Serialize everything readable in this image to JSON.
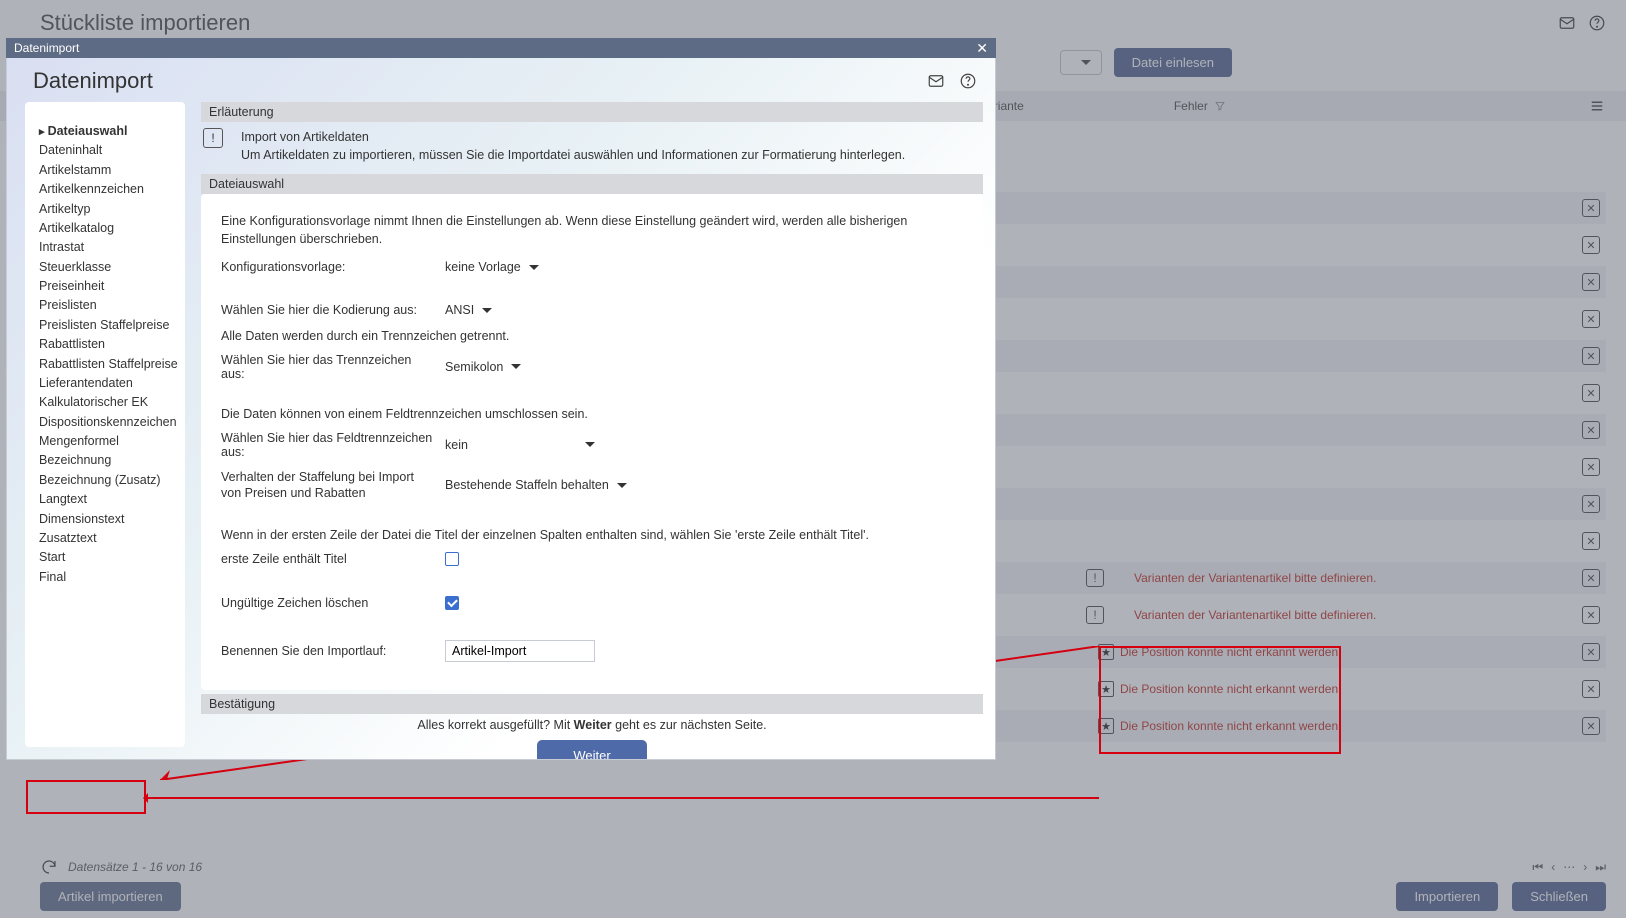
{
  "bg": {
    "title": "Stückliste importieren",
    "read_file_btn": "Datei einlesen",
    "columns": {
      "variante": "Variante",
      "fehler": "Fehler"
    },
    "footer_status": "Datensätze 1 - 16 von 16",
    "footer_btns": {
      "artikel": "Artikel importieren",
      "import": "Importieren",
      "close": "Schließen"
    },
    "rows": [
      {
        "type": "plain"
      },
      {
        "type": "plain"
      },
      {
        "type": "plain"
      },
      {
        "type": "plain"
      },
      {
        "type": "plain"
      },
      {
        "type": "plain"
      },
      {
        "type": "plain"
      },
      {
        "type": "plain"
      },
      {
        "type": "plain"
      },
      {
        "type": "plain"
      },
      {
        "type": "warn",
        "msg": "Varianten der Variantenartikel bitte definieren."
      },
      {
        "type": "warn",
        "msg": "Varianten der Variantenartikel bitte definieren."
      },
      {
        "type": "star",
        "msg": "Die Position konnte nicht erkannt werden."
      },
      {
        "type": "star",
        "msg": "Die Position konnte nicht erkannt werden."
      },
      {
        "type": "star",
        "msg": "Die Position konnte nicht erkannt werden."
      }
    ]
  },
  "modal": {
    "bar_title": "Datenimport",
    "title": "Datenimport",
    "nav": [
      "Dateiauswahl",
      "Dateninhalt",
      "Artikelstamm",
      "Artikelkennzeichen",
      "Artikeltyp",
      "Artikelkatalog",
      "Intrastat",
      "Steuerklasse",
      "Preiseinheit",
      "Preislisten",
      "Preislisten Staffelpreise",
      "Rabattlisten",
      "Rabattlisten Staffelpreise",
      "Lieferantendaten",
      "Kalkulatorischer EK",
      "Dispositionskennzeichen",
      "Mengenformel",
      "Bezeichnung",
      "Bezeichnung (Zusatz)",
      "Langtext",
      "Dimensionstext",
      "Zusatztext",
      "Start",
      "Final"
    ],
    "nav_selected": 0,
    "sect_erl": "Erläuterung",
    "erl_title": "Import von Artikeldaten",
    "erl_desc": "Um Artikeldaten zu importieren, müssen Sie die Importdatei auswählen und Informationen zur Formatierung hinterlegen.",
    "sect_file": "Dateiauswahl",
    "panel": {
      "intro": "Eine Konfigurationsvorlage nimmt Ihnen die Einstellungen ab. Wenn diese Einstellung geändert wird, werden alle bisherigen Einstellungen überschrieben.",
      "cfg_label": "Konfigurationsvorlage:",
      "cfg_value": "keine Vorlage",
      "enc_label": "Wählen Sie hier die Kodierung aus:",
      "enc_value": "ANSI",
      "sep_note": "Alle Daten werden durch ein Trennzeichen getrennt.",
      "sep_label": "Wählen Sie hier das Trennzeichen aus:",
      "sep_value": "Semikolon",
      "field_note": "Die Daten können von einem Feldtrennzeichen umschlossen sein.",
      "field_label": "Wählen Sie hier das Feldtrennzeichen aus:",
      "field_value": "kein",
      "scale_label": "Verhalten der Staffelung bei Import von Preisen und Rabatten",
      "scale_value": "Bestehende Staffeln behalten",
      "title_note": "Wenn in der ersten Zeile der Datei die Titel der einzelnen Spalten enthalten sind, wählen Sie 'erste Zeile enthält Titel'.",
      "title_chk_label": "erste Zeile enthält Titel",
      "title_chk": false,
      "invalid_label": "Ungültige Zeichen löschen",
      "invalid_chk": true,
      "name_label": "Benennen Sie den Importlauf:",
      "name_value": "Artikel-Import"
    },
    "sect_confirm": "Bestätigung",
    "confirm_pre": "Alles korrekt ausgefüllt?  Mit ",
    "confirm_bold": "Weiter",
    "confirm_post": " geht es zur nächsten Seite.",
    "next_btn": "Weiter"
  }
}
